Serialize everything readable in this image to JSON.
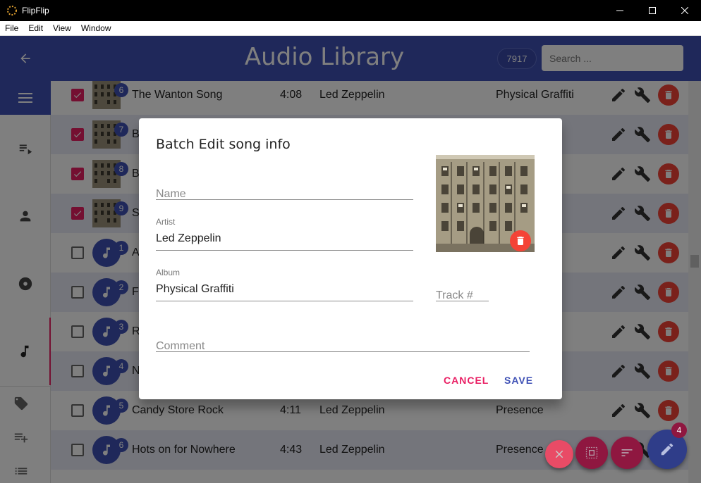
{
  "window": {
    "title": "FlipFlip",
    "controls": [
      "minimize",
      "maximize",
      "close"
    ]
  },
  "menu": [
    "File",
    "Edit",
    "View",
    "Window"
  ],
  "header": {
    "title": "Audio Library",
    "count": "7917",
    "search_placeholder": "Search ..."
  },
  "sidebar": {
    "items": [
      "menu-icon",
      "playlist-icon",
      "person-icon",
      "album-icon",
      "music-note-icon",
      "tag-icon",
      "playlist-add-icon",
      "list-icon"
    ],
    "active": "music-note-icon"
  },
  "rows": [
    {
      "checked": true,
      "art": "album",
      "track": "6",
      "name": "The Wanton Song",
      "duration": "4:08",
      "artist": "Led Zeppelin",
      "album": "Physical Graffiti"
    },
    {
      "checked": true,
      "art": "album",
      "track": "7",
      "name": "B",
      "duration": "",
      "artist": "",
      "album": "i"
    },
    {
      "checked": true,
      "art": "album",
      "track": "8",
      "name": "B",
      "duration": "",
      "artist": "",
      "album": "i"
    },
    {
      "checked": true,
      "art": "album",
      "track": "9",
      "name": "S",
      "duration": "",
      "artist": "",
      "album": "i"
    },
    {
      "checked": false,
      "art": "note",
      "track": "1",
      "name": "A",
      "duration": "",
      "artist": "",
      "album": ""
    },
    {
      "checked": false,
      "art": "note",
      "track": "2",
      "name": "F",
      "duration": "",
      "artist": "",
      "album": ""
    },
    {
      "checked": false,
      "art": "note",
      "track": "3",
      "name": "R",
      "duration": "",
      "artist": "",
      "album": ""
    },
    {
      "checked": false,
      "art": "note",
      "track": "4",
      "name": "N",
      "duration": "",
      "artist": "",
      "album": ""
    },
    {
      "checked": false,
      "art": "note",
      "track": "5",
      "name": "Candy Store Rock",
      "duration": "4:11",
      "artist": "Led Zeppelin",
      "album": "Presence"
    },
    {
      "checked": false,
      "art": "note",
      "track": "6",
      "name": "Hots on for Nowhere",
      "duration": "4:43",
      "artist": "Led Zeppelin",
      "album": "Presence"
    }
  ],
  "fabs": {
    "selected_count": "4"
  },
  "dialog": {
    "title": "Batch Edit song info",
    "name_placeholder": "Name",
    "artist_label": "Artist",
    "artist_value": "Led Zeppelin",
    "album_label": "Album",
    "album_value": "Physical Graffiti",
    "track_placeholder": "Track #",
    "comment_placeholder": "Comment",
    "cancel_label": "CANCEL",
    "save_label": "SAVE"
  },
  "colors": {
    "primary": "#3f51b5",
    "accent": "#e91e63",
    "danger": "#f44336"
  }
}
